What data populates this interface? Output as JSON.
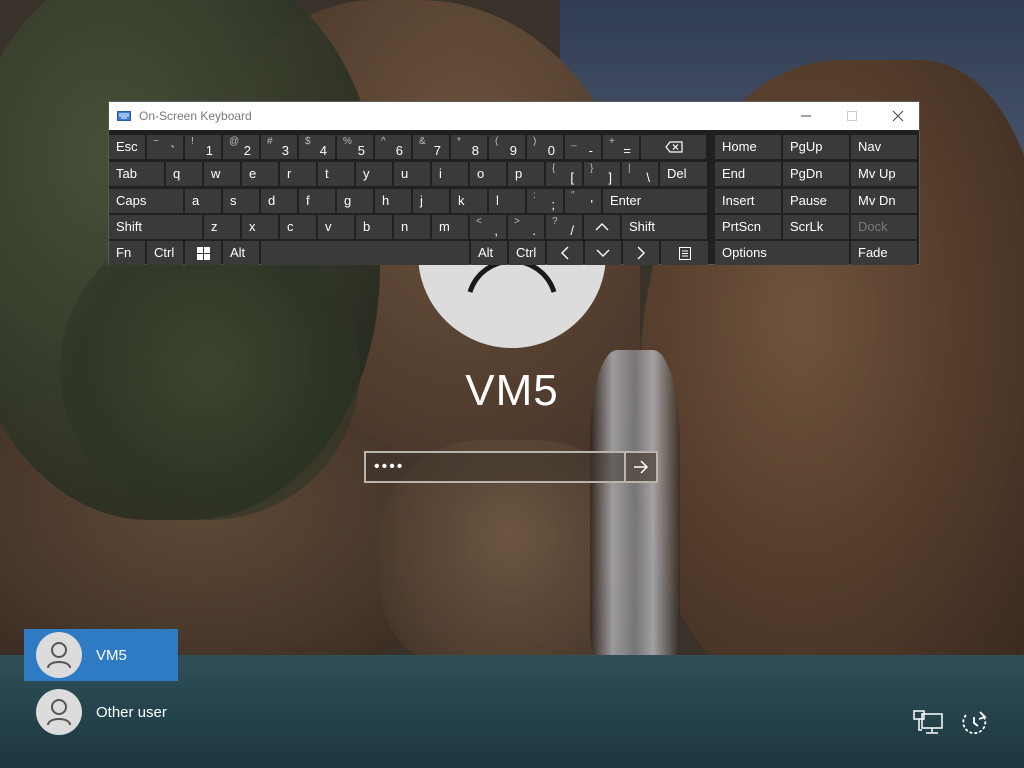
{
  "login": {
    "username": "VM5",
    "password_value": "••••"
  },
  "users": [
    {
      "name": "VM5",
      "selected": true
    },
    {
      "name": "Other user",
      "selected": false
    }
  ],
  "osk": {
    "title": "On-Screen Keyboard",
    "rows": [
      [
        {
          "label": "Esc"
        },
        {
          "shift": "~",
          "main": "`"
        },
        {
          "shift": "!",
          "main": "1"
        },
        {
          "shift": "@",
          "main": "2"
        },
        {
          "shift": "#",
          "main": "3"
        },
        {
          "shift": "$",
          "main": "4"
        },
        {
          "shift": "%",
          "main": "5"
        },
        {
          "shift": "^",
          "main": "6"
        },
        {
          "shift": "&",
          "main": "7"
        },
        {
          "shift": "*",
          "main": "8"
        },
        {
          "shift": "(",
          "main": "9"
        },
        {
          "shift": ")",
          "main": "0"
        },
        {
          "shift": "_",
          "main": "-"
        },
        {
          "shift": "+",
          "main": "="
        },
        {
          "icon": "backspace"
        },
        {
          "label": "Home"
        },
        {
          "label": "PgUp"
        },
        {
          "label": "Nav"
        }
      ],
      [
        {
          "label": "Tab"
        },
        {
          "label": "q"
        },
        {
          "label": "w"
        },
        {
          "label": "e"
        },
        {
          "label": "r"
        },
        {
          "label": "t"
        },
        {
          "label": "y"
        },
        {
          "label": "u"
        },
        {
          "label": "i"
        },
        {
          "label": "o"
        },
        {
          "label": "p"
        },
        {
          "shift": "{",
          "main": "["
        },
        {
          "shift": "}",
          "main": "]"
        },
        {
          "shift": "|",
          "main": "\\"
        },
        {
          "label": "Del"
        },
        {
          "label": "End"
        },
        {
          "label": "PgDn"
        },
        {
          "label": "Mv Up"
        }
      ],
      [
        {
          "label": "Caps"
        },
        {
          "label": "a"
        },
        {
          "label": "s"
        },
        {
          "label": "d"
        },
        {
          "label": "f"
        },
        {
          "label": "g"
        },
        {
          "label": "h"
        },
        {
          "label": "j"
        },
        {
          "label": "k"
        },
        {
          "label": "l"
        },
        {
          "shift": ":",
          "main": ";"
        },
        {
          "shift": "\"",
          "main": "'"
        },
        {
          "label": "Enter"
        },
        {
          "label": "Insert"
        },
        {
          "label": "Pause"
        },
        {
          "label": "Mv Dn"
        }
      ],
      [
        {
          "label": "Shift"
        },
        {
          "label": "z"
        },
        {
          "label": "x"
        },
        {
          "label": "c"
        },
        {
          "label": "v"
        },
        {
          "label": "b"
        },
        {
          "label": "n"
        },
        {
          "label": "m"
        },
        {
          "shift": "<",
          "main": ","
        },
        {
          "shift": ">",
          "main": "."
        },
        {
          "shift": "?",
          "main": "/"
        },
        {
          "icon": "arrow-up"
        },
        {
          "label": "Shift"
        },
        {
          "label": "PrtScn"
        },
        {
          "label": "ScrLk"
        },
        {
          "label": "Dock",
          "disabled": true
        }
      ],
      [
        {
          "label": "Fn"
        },
        {
          "label": "Ctrl"
        },
        {
          "icon": "windows"
        },
        {
          "label": "Alt"
        },
        {
          "label": ""
        },
        {
          "label": "Alt"
        },
        {
          "label": "Ctrl"
        },
        {
          "icon": "arrow-left"
        },
        {
          "icon": "arrow-down"
        },
        {
          "icon": "arrow-right"
        },
        {
          "icon": "menu"
        },
        {
          "label": "Options"
        },
        {
          "label": "Fade"
        }
      ]
    ]
  },
  "colors": {
    "accent": "#2e7bc4",
    "key_bg": "#3a3a3a",
    "osk_bg": "#202020"
  },
  "icons": {
    "network": "network-icon",
    "ease_of_access": "ease-of-access-icon",
    "loading": "loading-spinner-icon"
  }
}
